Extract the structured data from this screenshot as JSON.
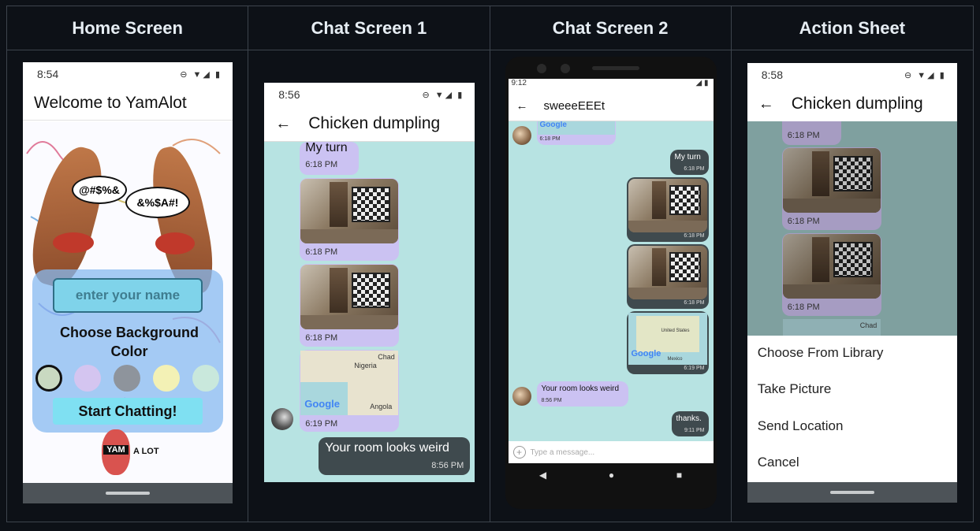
{
  "headers": [
    "Home Screen",
    "Chat Screen 1",
    "Chat Screen 2",
    "Action Sheet"
  ],
  "home": {
    "time": "8:54",
    "status_icons": "⊖ ▼◢ ▮",
    "title": "Welcome to YamAlot",
    "speech_left": "@#$%&",
    "speech_right": "&%$A#!",
    "name_placeholder": "enter your name",
    "choose_label": "Choose Background Color",
    "colors": [
      "#c9d9c1",
      "#d4c5f0",
      "#8e949c",
      "#f3f1b5",
      "#c9e8dc"
    ],
    "start_button": "Start Chatting!",
    "logo_yam": "YAM",
    "logo_alot": "A LOT"
  },
  "chat1": {
    "time": "8:56",
    "title": "Chicken dumpling",
    "msg_myturn": "My turn",
    "ts1": "6:18 PM",
    "ts2": "6:18 PM",
    "ts3": "6:18 PM",
    "ts4": "6:19 PM",
    "map_label_nigeria": "Nigeria",
    "map_label_chad": "Chad",
    "map_label_angola": "Angola",
    "map_logo": "Google",
    "sent_text": "Your room looks weird",
    "sent_time": "8:56 PM"
  },
  "chat2": {
    "time": "9:12",
    "title": "sweeeEEEt",
    "msg_myturn": "My turn",
    "ts_top": "6:18 PM",
    "ts1": "6:18 PM",
    "ts2": "6:18 PM",
    "ts3": "6:18 PM",
    "ts4": "6:19 PM",
    "map_logo": "Google",
    "map_label_us": "United States",
    "map_label_mexico": "Mexico",
    "received_text": "Your room looks weird",
    "received_time": "8:56 PM",
    "sent_text": "thanks.",
    "sent_time": "9:11 PM",
    "input_placeholder": "Type a message..."
  },
  "action": {
    "time": "8:58",
    "title": "Chicken dumpling",
    "ts1": "6:18 PM",
    "ts2": "6:18 PM",
    "ts3": "6:18 PM",
    "map_label_chad": "Chad",
    "options": [
      "Choose From Library",
      "Take Picture",
      "Send Location",
      "Cancel"
    ]
  }
}
